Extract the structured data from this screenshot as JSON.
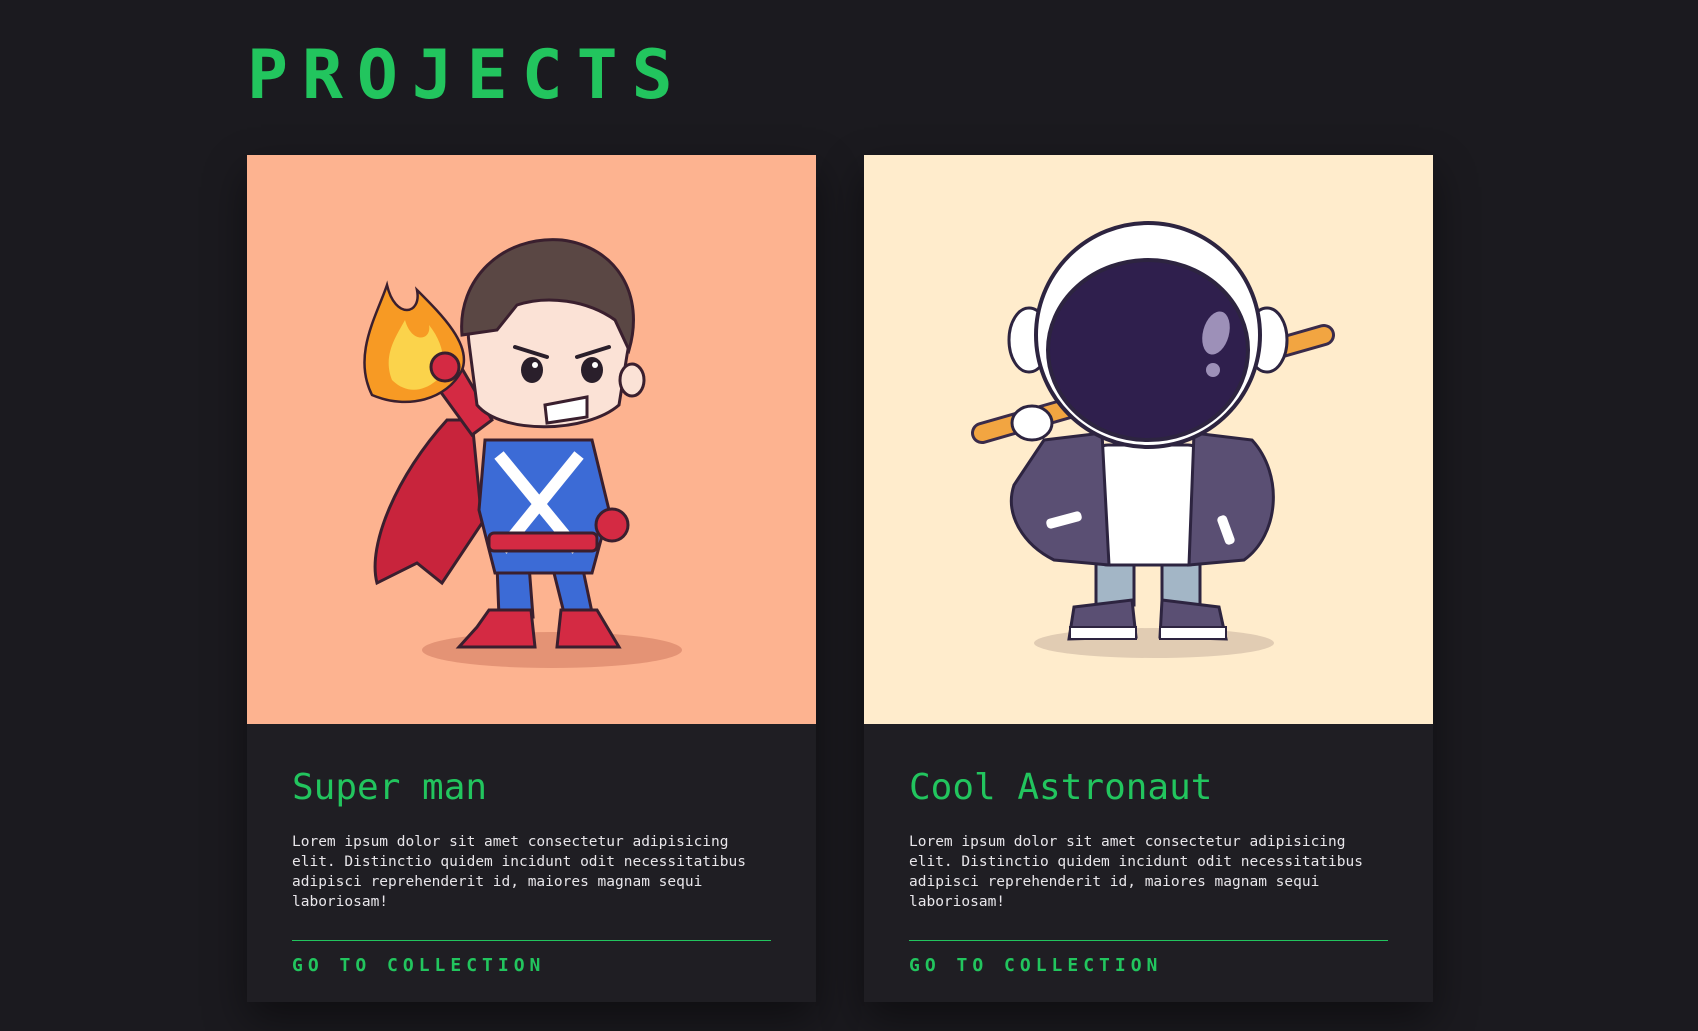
{
  "page": {
    "title": "PROJECTS"
  },
  "colors": {
    "accent": "#22c55e",
    "background": "#1b1a1f",
    "card": "#1f1e23"
  },
  "projects": [
    {
      "title": "Super man",
      "description": "Lorem ipsum dolor sit amet consectetur adipisicing elit. Distinctio quidem incidunt odit necessitatibus adipisci reprehenderit id, maiores magnam sequi laboriosam!",
      "link_label": "GO TO COLLECTION",
      "image": {
        "subject": "superhero-illustration",
        "background": "#fdb390"
      }
    },
    {
      "title": "Cool Astronaut",
      "description": "Lorem ipsum dolor sit amet consectetur adipisicing elit. Distinctio quidem incidunt odit necessitatibus adipisci reprehenderit id, maiores magnam sequi laboriosam!",
      "link_label": "GO TO COLLECTION",
      "image": {
        "subject": "astronaut-illustration",
        "background": "#ffeccc"
      }
    }
  ]
}
